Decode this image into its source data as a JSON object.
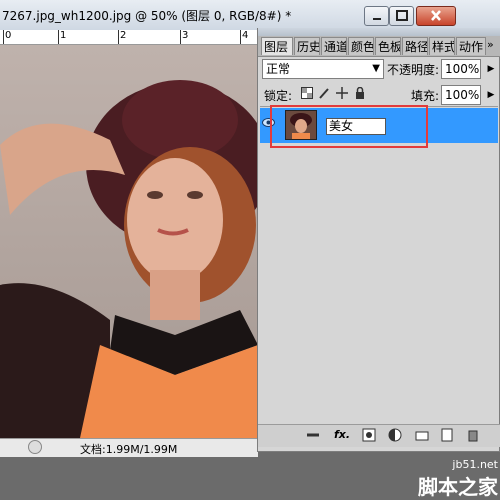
{
  "document": {
    "title": "7267.jpg_wh1200.jpg @ 50% (图层 0, RGB/8#) *",
    "ruler_numbers": [
      "0",
      "1",
      "2",
      "3",
      "4"
    ],
    "status_text": "文档:1.99M/1.99M"
  },
  "window_controls": {
    "minimize": "minimize",
    "maximize": "maximize",
    "close": "close"
  },
  "panel": {
    "tabs": [
      "图层",
      "历史",
      "通道",
      "颜色",
      "色板",
      "路径",
      "样式",
      "动作"
    ],
    "tab_scroll": "»",
    "blend_mode": "正常",
    "opacity_label": "不透明度:",
    "opacity_value": "100%",
    "lock_label": "锁定:",
    "fill_label": "填充:",
    "fill_value": "100%",
    "layer_name": "美女",
    "bottom_icons": [
      "link-icon",
      "fx-icon",
      "mask-icon",
      "adjustment-icon",
      "folder-icon",
      "new-layer-icon",
      "trash-icon"
    ],
    "fx_label": "fx."
  },
  "watermark": {
    "line1": "jb51.net",
    "line2": "脚本之家"
  },
  "colors": {
    "selection": "#3399ff",
    "highlight": "#e23b3b",
    "panel_bg": "#d6d6d6"
  }
}
